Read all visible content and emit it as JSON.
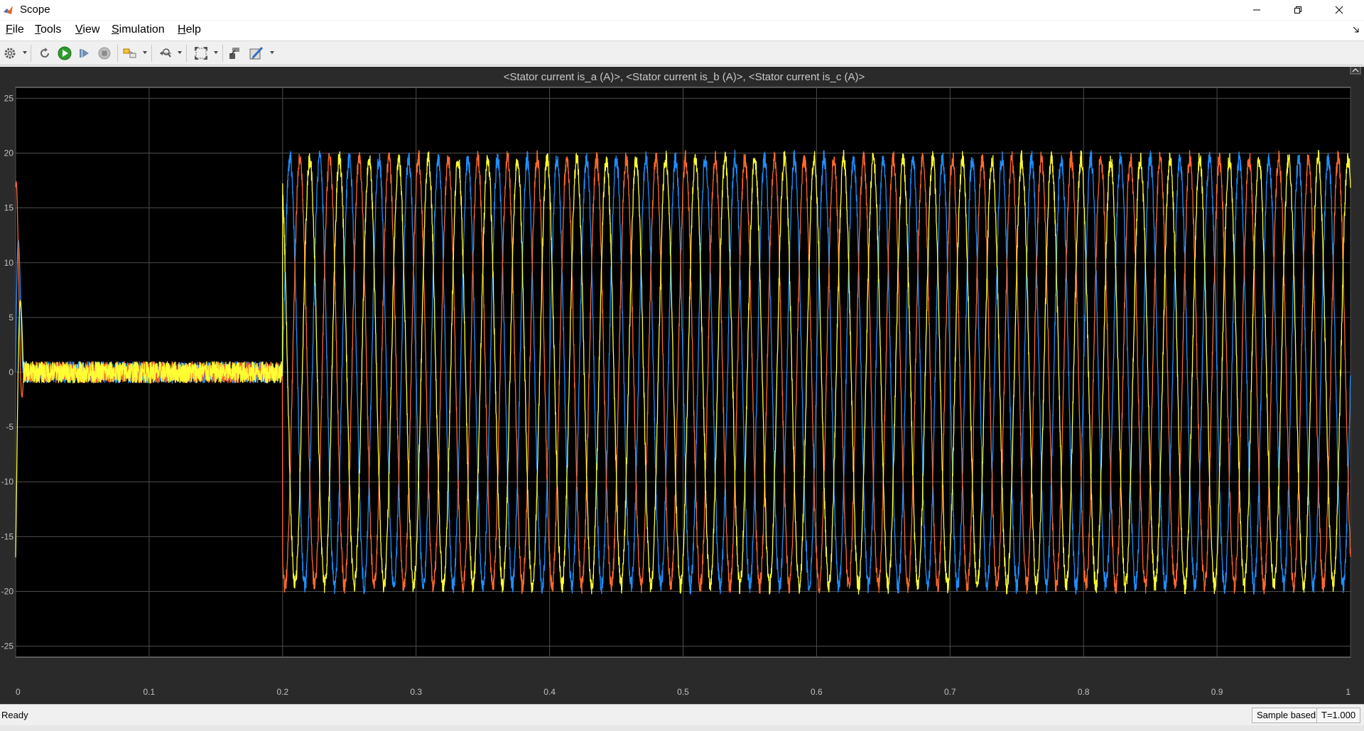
{
  "window": {
    "title": "Scope"
  },
  "menubar": {
    "items": [
      {
        "label": "File",
        "mnemonic": "F",
        "rest": "ile"
      },
      {
        "label": "Tools",
        "mnemonic": "T",
        "rest": "ools"
      },
      {
        "label": "View",
        "mnemonic": "V",
        "rest": "iew"
      },
      {
        "label": "Simulation",
        "mnemonic": "S",
        "rest": "imulation"
      },
      {
        "label": "Help",
        "mnemonic": "H",
        "rest": "elp"
      }
    ]
  },
  "toolbar": {
    "icons": [
      "settings-icon",
      "step-back-icon",
      "run-icon",
      "step-forward-icon",
      "stop-icon",
      "highlight-simulink-block-icon",
      "zoom-icon",
      "autoscale-icon",
      "restore-view-icon",
      "style-icon"
    ]
  },
  "colors": {
    "plot_background": "#000000",
    "figure_background": "#2a2a2a",
    "grid": "#4d4d4d",
    "axis_text": "#c0c0c0",
    "series_a": "#1e90ff",
    "series_b": "#ff6a2a",
    "series_c": "#ffff33"
  },
  "chart_data": {
    "type": "line",
    "title": "<Stator current is_a (A)>, <Stator current is_b (A)>, <Stator current is_c (A)>",
    "xlabel": "",
    "ylabel": "",
    "xlim": [
      0,
      1
    ],
    "ylim": [
      -26,
      26
    ],
    "xticks": [
      0,
      0.1,
      0.2,
      0.3,
      0.4,
      0.5,
      0.6,
      0.7,
      0.8,
      0.9,
      1
    ],
    "xtick_labels": [
      "0",
      "0.1",
      "0.2",
      "0.3",
      "0.4",
      "0.5",
      "0.6",
      "0.7",
      "0.8",
      "0.9",
      "1"
    ],
    "yticks": [
      -25,
      -20,
      -15,
      -10,
      -5,
      0,
      5,
      10,
      15,
      20,
      25
    ],
    "ytick_labels": [
      "-25",
      "-20",
      "-15",
      "-10",
      "-5",
      "0",
      "5",
      "10",
      "15",
      "20",
      "25"
    ],
    "grid": true,
    "legend": "none",
    "description_values": {
      "idle_interval": [
        0,
        0.2
      ],
      "idle_amplitude": 1,
      "steady_start": 0.2,
      "steady_amplitude": 19.5,
      "frequency_hz": 45,
      "ripple_amplitude": 0.8,
      "startup_peak": 20,
      "startup_min": -19.5
    },
    "series": [
      {
        "color": "#1e90ff",
        "phase_deg": 0
      },
      {
        "color": "#ff6a2a",
        "phase_deg": -120
      },
      {
        "color": "#ffff33",
        "phase_deg": 120
      }
    ]
  },
  "statusbar": {
    "status": "Ready",
    "sample_mode": "Sample based",
    "time": "T=1.000"
  }
}
